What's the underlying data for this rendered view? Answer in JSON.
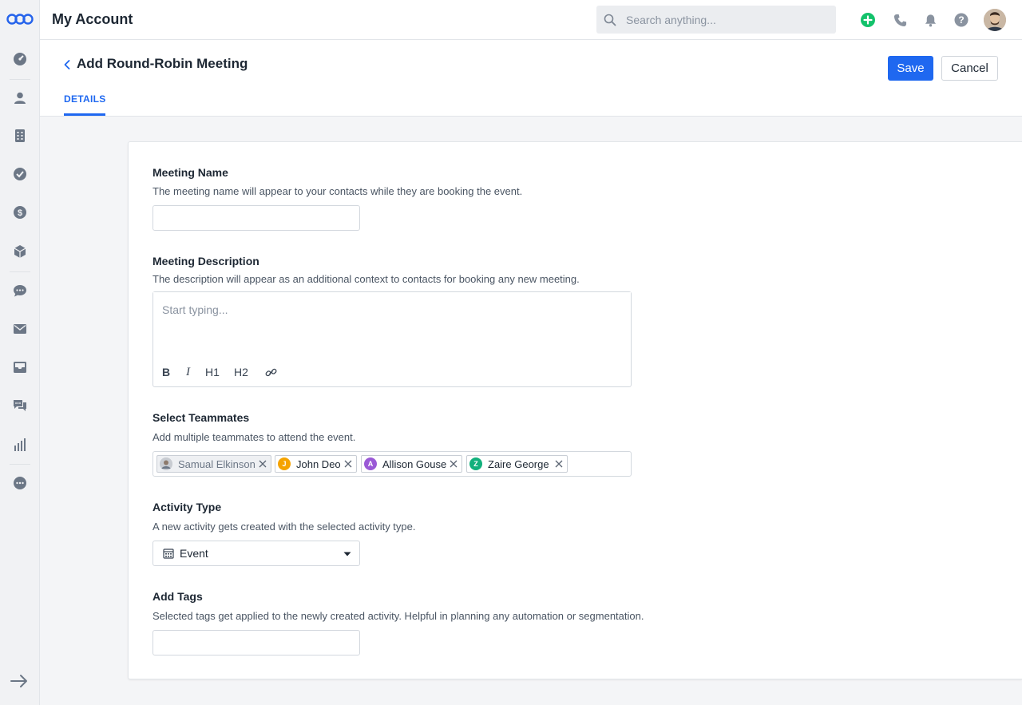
{
  "app": {
    "title": "My Account",
    "search_placeholder": "Search anything..."
  },
  "sidebar": {
    "items": [
      {
        "icon": "dashboard-icon"
      },
      {
        "icon": "contacts-icon"
      },
      {
        "icon": "accounts-icon"
      },
      {
        "icon": "tasks-icon"
      },
      {
        "icon": "deals-icon"
      },
      {
        "icon": "products-icon"
      },
      {
        "icon": "chat-icon"
      },
      {
        "icon": "email-icon"
      },
      {
        "icon": "inbox-icon"
      },
      {
        "icon": "messages-icon"
      },
      {
        "icon": "reports-icon"
      },
      {
        "icon": "more-icon"
      }
    ]
  },
  "page": {
    "title": "Add Round-Robin Meeting",
    "save_label": "Save",
    "cancel_label": "Cancel",
    "tab_details": "DETAILS"
  },
  "form": {
    "meeting_name": {
      "label": "Meeting Name",
      "help": "The meeting name will appear to your contacts while they are booking the event.",
      "value": ""
    },
    "meeting_description": {
      "label": "Meeting Description",
      "help": "The description will appear as an additional context to contacts for booking any new meeting.",
      "placeholder": "Start typing...",
      "toolbar": {
        "bold": "B",
        "italic": "I",
        "h1": "H1",
        "h2": "H2"
      }
    },
    "teammates": {
      "label": "Select Teammates",
      "help": "Add multiple teammates to attend the event.",
      "chips": [
        {
          "name": "Samual Elkinson",
          "initial": "",
          "color": "#9aa3ad",
          "disabled": true
        },
        {
          "name": "John Deo",
          "initial": "J",
          "color": "#f5a300"
        },
        {
          "name": "Allison Gouse",
          "initial": "A",
          "color": "#9a59d6"
        },
        {
          "name": "Zaire George",
          "initial": "Z",
          "color": "#12b07c"
        }
      ]
    },
    "activity_type": {
      "label": "Activity Type",
      "help": "A new activity gets created with the selected activity type.",
      "value": "Event"
    },
    "tags": {
      "label": "Add Tags",
      "help": "Selected tags get applied to the newly created activity. Helpful in planning any automation or segmentation.",
      "value": ""
    }
  },
  "colors": {
    "primary": "#1f68f0",
    "add_green": "#13c26b"
  }
}
